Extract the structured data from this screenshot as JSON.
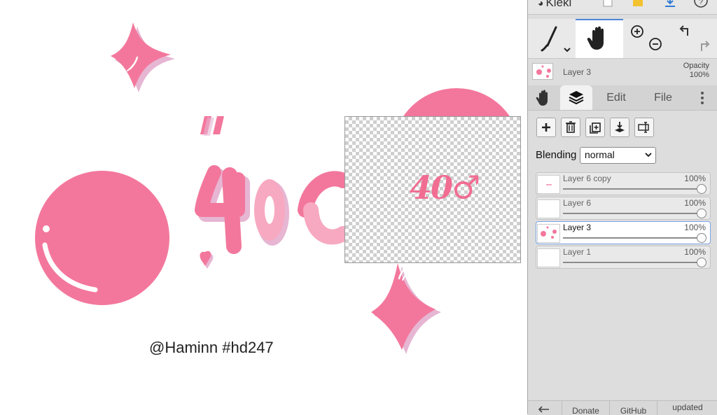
{
  "canvas": {
    "credit_text": "@Haminn #hd247",
    "preview_text": "40♂"
  },
  "app": {
    "name": "Kleki",
    "accent": "#4e86d8"
  },
  "current_layer": {
    "name": "Layer 3",
    "opacity_label": "Opacity",
    "opacity_value": "100%"
  },
  "tabs": {
    "edit": "Edit",
    "file": "File"
  },
  "blending": {
    "label": "Blending",
    "value": "normal"
  },
  "layers": [
    {
      "name": "Layer 6 copy",
      "opacity": "100%",
      "selected": false
    },
    {
      "name": "Layer 6",
      "opacity": "100%",
      "selected": false
    },
    {
      "name": "Layer 3",
      "opacity": "100%",
      "selected": true
    },
    {
      "name": "Layer 1",
      "opacity": "100%",
      "selected": false
    }
  ],
  "footer": {
    "donate": "Donate",
    "github": "GitHub",
    "updated": "updated"
  },
  "colors": {
    "pink": "#f3779c",
    "pink_light": "#f7a9c1",
    "shadow": "#e6b6d3"
  }
}
